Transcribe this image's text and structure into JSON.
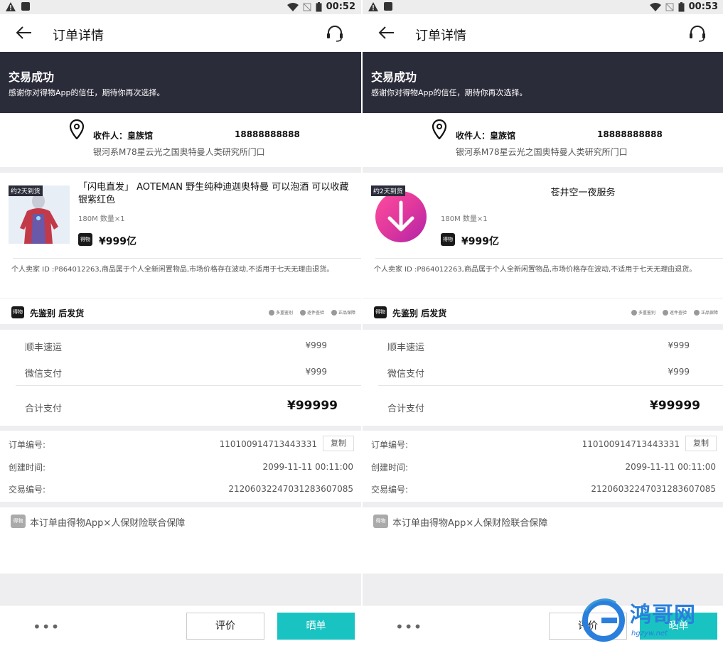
{
  "screens": [
    {
      "status": {
        "time": "00:52"
      },
      "nav": {
        "title": "订单详情"
      },
      "banner": {
        "title": "交易成功",
        "subtitle": "感谢你对得物App的信任，期待你再次选择。"
      },
      "address": {
        "recipient": "收件人：皇族馆",
        "phone": "18888888888",
        "address": "银河系M78星云光之国奥特曼人类研究所门口"
      },
      "product": {
        "tag": "约2天到货",
        "title": "「闪电直发」 AOTEMAN 野生纯种迪迦奥特曼 可以泡酒 可以收藏 银紫红色",
        "spec": "180M 数量×1",
        "logo": "得物",
        "price": "¥999亿",
        "note": "个人卖家 ID :P864012263,商品属于个人全新闲置物品,市场价格存在波动,不适用于七天无理由退货。",
        "badge_logo": "得物",
        "badge": "先鉴别 后发货",
        "services": [
          "多重鉴别",
          "逐件查验",
          "正品保障"
        ]
      },
      "payment": {
        "rows": [
          {
            "label": "顺丰速运",
            "value": "¥999"
          },
          {
            "label": "微信支付",
            "value": "¥999"
          }
        ],
        "total_label": "合计支付",
        "total_value": "¥99999"
      },
      "info": {
        "order_no_label": "订单编号:",
        "order_no": "110100914713443331",
        "copy": "复制",
        "created_label": "创建时间:",
        "created": "2099-11-11 00:11:00",
        "trade_label": "交易编号:",
        "trade": "21206032247031283607085"
      },
      "guarantee": {
        "logo": "得物",
        "text": "本订单由得物App×人保财险联合保障"
      },
      "bottom": {
        "more": "•••",
        "review": "评价",
        "show": "晒单"
      }
    },
    {
      "status": {
        "time": "00:53"
      },
      "nav": {
        "title": "订单详情"
      },
      "banner": {
        "title": "交易成功",
        "subtitle": "感谢你对得物App的信任，期待你再次选择。"
      },
      "address": {
        "recipient": "收件人：皇族馆",
        "phone": "18888888888",
        "address": "银河系M78星云光之国奥特曼人类研究所门口"
      },
      "product": {
        "tag": "约2天到货",
        "title": "苍井空一夜服务",
        "spec": "180M 数量×1",
        "logo": "得物",
        "price": "¥999亿",
        "note": "个人卖家 ID :P864012263,商品属于个人全新闲置物品,市场价格存在波动,不适用于七天无理由退货。",
        "badge_logo": "得物",
        "badge": "先鉴别 后发货",
        "services": [
          "多重鉴别",
          "逐件查验",
          "正品保障"
        ]
      },
      "payment": {
        "rows": [
          {
            "label": "顺丰速运",
            "value": "¥999"
          },
          {
            "label": "微信支付",
            "value": "¥999"
          }
        ],
        "total_label": "合计支付",
        "total_value": "¥99999"
      },
      "info": {
        "order_no_label": "订单编号:",
        "order_no": "110100914713443331",
        "copy": "复制",
        "created_label": "创建时间:",
        "created": "2099-11-11 00:11:00",
        "trade_label": "交易编号:",
        "trade": "21206032247031283607085"
      },
      "guarantee": {
        "logo": "得物",
        "text": "本订单由得物App×人保财险联合保障"
      },
      "bottom": {
        "more": "•••",
        "review": "评价",
        "show": "晒单"
      }
    }
  ],
  "watermark": {
    "text": "鸿哥网",
    "sub": "hgzyw.net"
  },
  "colors": {
    "banner": "#2b2c3a",
    "accent": "#19c3c1",
    "watermark": "#2a7fdc"
  }
}
